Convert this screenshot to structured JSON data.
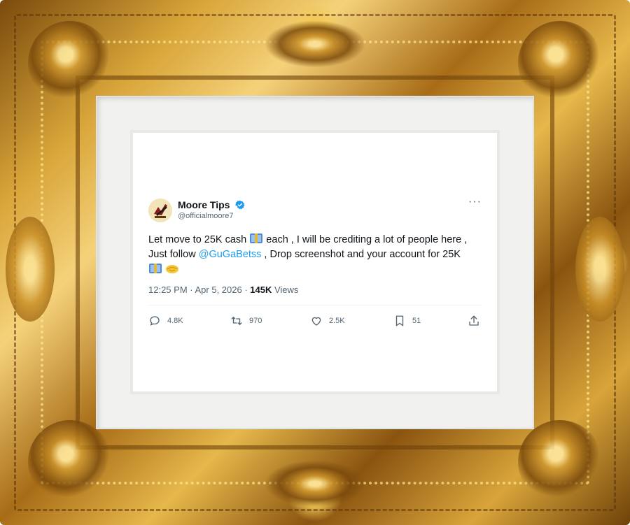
{
  "tweet": {
    "display_name": "Moore Tips",
    "handle": "@officialmoore7",
    "text_part1": "Let move to 25K cash ",
    "text_part2": " each , I will be crediting a lot of people here , Just follow ",
    "mention": "@GuGaBetss",
    "text_part3": " , Drop screenshot and your account for 25K ",
    "time": "12:25 PM",
    "date": "Apr 5, 2026",
    "views_count": "145K",
    "views_label": "Views",
    "more_label": "···",
    "stats": {
      "replies": "4.8K",
      "retweets": "970",
      "likes": "2.5K",
      "bookmarks": "51"
    }
  },
  "icons": {
    "avatar": "avatar-logo",
    "verified": "verified-badge-icon",
    "money": "money-bag-icon",
    "handshake": "handshake-icon",
    "reply": "reply-icon",
    "retweet": "retweet-icon",
    "like": "heart-icon",
    "bookmark": "bookmark-icon",
    "share": "share-icon"
  },
  "colors": {
    "frame_gold": "#d9a63a",
    "mat": "#f1f1f0",
    "card": "#ffffff",
    "link": "#1d9bf0",
    "verified": "#1d9bf0",
    "text": "#0f1419",
    "muted": "#536471"
  }
}
